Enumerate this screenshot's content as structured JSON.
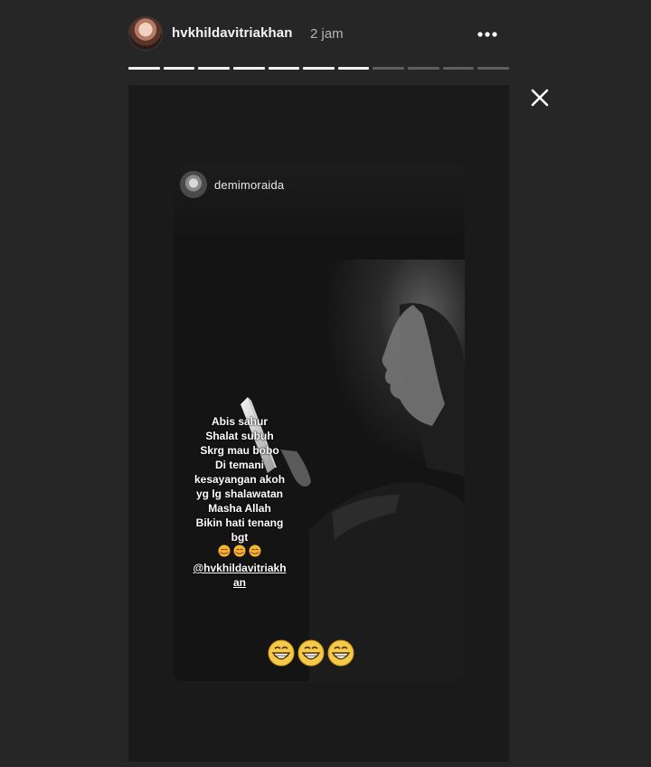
{
  "header": {
    "username": "hvkhildavitriakhan",
    "time": "2 jam",
    "more_icon": "more-horizontal-icon",
    "close_icon": "close-icon"
  },
  "progress": {
    "total_segments": 11,
    "completed_segments": 7
  },
  "story_card": {
    "username": "demimoraida",
    "caption_lines": [
      "Abis sahur",
      "Shalat subuh",
      "Skrg mau bobo",
      "Di temani",
      "kesayangan akoh",
      "yg lg shalawatan",
      "Masha Allah",
      "Bikin hati tenang",
      "bgt"
    ],
    "caption_emoji": "blushing-face-emoji x3",
    "mention_line1": "@hvkhildavitriakh",
    "mention_line2": "an",
    "sticker": "grinning-face-emoji x3"
  },
  "colors": {
    "background": "#262626",
    "story_bg": "#1a1a1a",
    "progress_done": "#f2f2f2",
    "progress_todo": "#5e5e5e"
  }
}
